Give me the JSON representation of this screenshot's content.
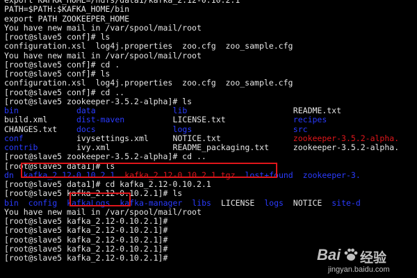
{
  "colors": {
    "background": "#000000",
    "text": "#e6e6e6",
    "directory": "#2a3bff",
    "archive": "#e0161b",
    "highlight_box": "#e0161b"
  },
  "terminal": {
    "lines": [
      [
        {
          "text": "export KAFKA_HOME=/hdfs/data1/kafka_2.12-0.10.2.1",
          "color": "text"
        }
      ],
      [
        {
          "text": "PATH=$PATH:$KAFKA_HOME/bin",
          "color": "text"
        }
      ],
      [
        {
          "text": "export PATH ZOOKEEPER_HOME",
          "color": "text"
        }
      ],
      [
        {
          "text": "You have new mail in /var/spool/mail/root",
          "color": "text"
        }
      ],
      [
        {
          "text": "[root@slave5 conf]# ls",
          "color": "text"
        }
      ],
      [
        {
          "text": "configuration.xsl  log4j.properties  zoo.cfg  zoo_sample.cfg",
          "color": "text"
        }
      ],
      [
        {
          "text": "You have new mail in /var/spool/mail/root",
          "color": "text"
        }
      ],
      [
        {
          "text": "[root@slave5 conf]# cd .",
          "color": "text"
        }
      ],
      [
        {
          "text": "[root@slave5 conf]# ls",
          "color": "text"
        }
      ],
      [
        {
          "text": "configuration.xsl  log4j.properties  zoo.cfg  zoo_sample.cfg",
          "color": "text"
        }
      ],
      [
        {
          "text": "[root@slave5 conf]# cd ..",
          "color": "text"
        }
      ],
      [
        {
          "text": "[root@slave5 zookeeper-3.5.2-alpha]# ls",
          "color": "text"
        }
      ],
      [
        {
          "text": "bin",
          "color": "directory",
          "col": 0
        },
        {
          "text": "data",
          "color": "directory",
          "col": 15
        },
        {
          "text": "lib",
          "color": "directory",
          "col": 35
        },
        {
          "text": "README.txt",
          "color": "text",
          "col": 60
        }
      ],
      [
        {
          "text": "build.xml",
          "color": "text",
          "col": 0
        },
        {
          "text": "dist-maven",
          "color": "directory",
          "col": 15
        },
        {
          "text": "LICENSE.txt",
          "color": "text",
          "col": 35
        },
        {
          "text": "recipes",
          "color": "directory",
          "col": 60
        }
      ],
      [
        {
          "text": "CHANGES.txt",
          "color": "text",
          "col": 0
        },
        {
          "text": "docs",
          "color": "directory",
          "col": 15
        },
        {
          "text": "logs",
          "color": "directory",
          "col": 35
        },
        {
          "text": "src",
          "color": "directory",
          "col": 60
        }
      ],
      [
        {
          "text": "conf",
          "color": "directory",
          "col": 0
        },
        {
          "text": "ivysettings.xml",
          "color": "text",
          "col": 15
        },
        {
          "text": "NOTICE.txt",
          "color": "text",
          "col": 35
        },
        {
          "text": "zookeeper-3.5.2-alpha.",
          "color": "archive",
          "col": 60
        }
      ],
      [
        {
          "text": "contrib",
          "color": "directory",
          "col": 0
        },
        {
          "text": "ivy.xml",
          "color": "text",
          "col": 15
        },
        {
          "text": "README_packaging.txt",
          "color": "text",
          "col": 35
        },
        {
          "text": "zookeeper-3.5.2-alpha.",
          "color": "text",
          "col": 60
        }
      ],
      [
        {
          "text": "[root@slave5 zookeeper-3.5.2-alpha]# cd ..",
          "color": "text"
        }
      ],
      [
        {
          "text": "[root@slave5 data1]# ls",
          "color": "text"
        }
      ],
      [
        {
          "text": "dn",
          "color": "directory",
          "col": 0
        },
        {
          "text": "kafka_2.12-0.10.2.1",
          "color": "directory",
          "col": 4
        },
        {
          "text": "kafka_2.12-0.10.2.1.tgz",
          "color": "archive",
          "col": 25
        },
        {
          "text": "lost+found",
          "color": "directory",
          "col": 50
        },
        {
          "text": "zookeeper-3.",
          "color": "directory",
          "col": 62
        }
      ],
      [
        {
          "text": "[root@slave5 data1]# cd kafka_2.12-0.10.2.1",
          "color": "text"
        }
      ],
      [
        {
          "text": "[root@slave5 kafka_2.12-0.10.2.1]# ls",
          "color": "text"
        }
      ],
      [
        {
          "text": "bin",
          "color": "directory",
          "col": 0
        },
        {
          "text": "config",
          "color": "directory",
          "col": 5
        },
        {
          "text": "kafkaLogs",
          "color": "directory",
          "col": 13
        },
        {
          "text": "kafka-manager",
          "color": "directory",
          "col": 24
        },
        {
          "text": "libs",
          "color": "directory",
          "col": 39
        },
        {
          "text": "LICENSE",
          "color": "text",
          "col": 45
        },
        {
          "text": "logs",
          "color": "directory",
          "col": 54
        },
        {
          "text": "NOTICE",
          "color": "text",
          "col": 60
        },
        {
          "text": "site-d",
          "color": "directory",
          "col": 68
        }
      ],
      [
        {
          "text": "You have new mail in /var/spool/mail/root",
          "color": "text"
        }
      ],
      [
        {
          "text": "[root@slave5 kafka_2.12-0.10.2.1]#",
          "color": "text"
        }
      ],
      [
        {
          "text": "[root@slave5 kafka_2.12-0.10.2.1]#",
          "color": "text"
        }
      ],
      [
        {
          "text": "[root@slave5 kafka_2.12-0.10.2.1]#",
          "color": "text"
        }
      ],
      [
        {
          "text": "[root@slave5 kafka_2.12-0.10.2.1]#",
          "color": "text"
        }
      ],
      [
        {
          "text": "[root@slave5 kafka_2.12-0.10.2.1]#",
          "color": "text"
        }
      ]
    ]
  },
  "watermark": {
    "brand": "Bai",
    "brand_suffix": "经验",
    "url": "jingyan.baidu.com"
  }
}
